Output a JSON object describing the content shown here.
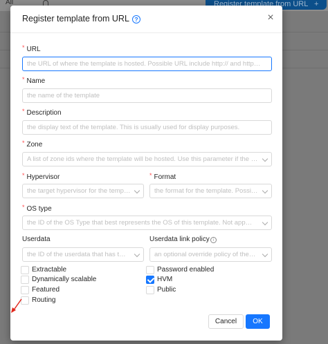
{
  "background": {
    "filter_label": "All",
    "register_button_label": "Register template from URL",
    "register_button_plus": "+"
  },
  "modal": {
    "title": "Register template from URL",
    "help_icon": "question-circle-icon",
    "close_icon": "close-icon",
    "close_glyph": "×",
    "help_glyph": "?"
  },
  "fields": {
    "url": {
      "label": "URL",
      "required": true,
      "placeholder": "the URL of where the template is hosted. Possible URL include http:// and http…"
    },
    "name": {
      "label": "Name",
      "required": true,
      "placeholder": "the name of the template"
    },
    "description": {
      "label": "Description",
      "required": true,
      "placeholder": "the display text of the template. This is usually used for display purposes."
    },
    "zone": {
      "label": "Zone",
      "required": true,
      "placeholder": "A list of zone ids where the template will be hosted. Use this parameter if the …"
    },
    "hypervisor": {
      "label": "Hypervisor",
      "required": true,
      "placeholder": "the target hypervisor for the templ…"
    },
    "format": {
      "label": "Format",
      "required": true,
      "placeholder": "the format for the template. Possi…"
    },
    "os_type": {
      "label": "OS type",
      "required": true,
      "placeholder": "the ID of the OS Type that best represents the OS of this template. Not app…"
    },
    "userdata": {
      "label": "Userdata",
      "required": false,
      "placeholder": "the ID of the userdata that has t…"
    },
    "userdata_link_policy": {
      "label": "Userdata link policy",
      "required": false,
      "placeholder": "an optional override policy of the…",
      "info_glyph": "i"
    }
  },
  "checkboxes": {
    "left": [
      {
        "label": "Extractable",
        "checked": false
      },
      {
        "label": "Dynamically scalable",
        "checked": false
      },
      {
        "label": "Featured",
        "checked": false
      },
      {
        "label": "Routing",
        "checked": false
      }
    ],
    "right": [
      {
        "label": "Password enabled",
        "checked": false
      },
      {
        "label": "HVM",
        "checked": true
      },
      {
        "label": "Public",
        "checked": false
      }
    ]
  },
  "footer": {
    "cancel_label": "Cancel",
    "ok_label": "OK"
  },
  "colors": {
    "primary": "#1677ff",
    "required": "#ff4d4f",
    "annotation_arrow": "#e0261b"
  },
  "req_mark": "*"
}
